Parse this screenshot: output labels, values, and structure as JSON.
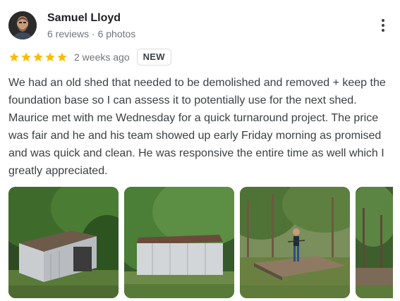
{
  "reviewer": {
    "name": "Samuel Lloyd",
    "meta": "6 reviews · 6 photos",
    "avatar_icon": "person-avatar"
  },
  "menu": {
    "icon": "more-vert-icon"
  },
  "rating": {
    "stars": 5,
    "max_stars": 5,
    "star_color": "#fbbc04",
    "time": "2 weeks ago",
    "badge": "NEW"
  },
  "review": {
    "text": "We had an old shed that needed to be demolished and removed + keep the foundation base so I can assess it to potentially use for the next shed. Maurice met with me Wednesday for a quick turnaround project. The price was fair and he and his team showed up early Friday morning as promised and was quick and clean. He was responsive the entire time as well which I greatly appreciated."
  },
  "photos": [
    {
      "subject": "shed-before-photo"
    },
    {
      "subject": "shed-side-photo"
    },
    {
      "subject": "foundation-after-photo"
    },
    {
      "subject": "cleared-site-photo"
    }
  ]
}
